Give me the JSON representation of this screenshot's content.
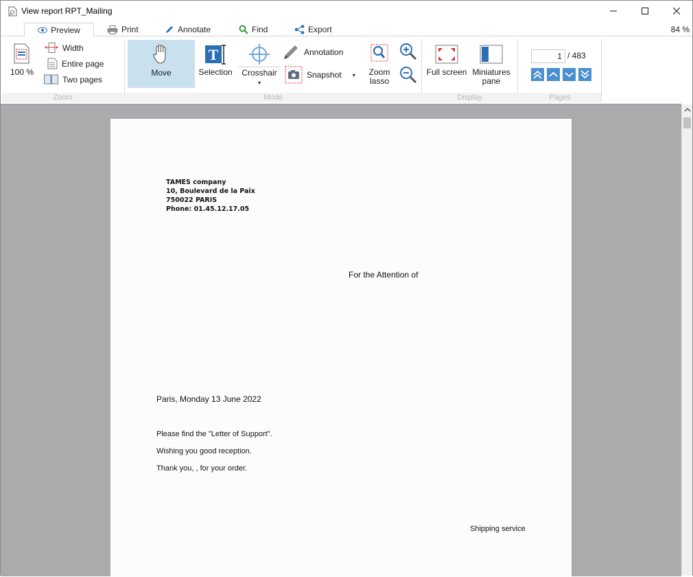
{
  "window": {
    "title": "View report RPT_Mailing"
  },
  "tabs": [
    {
      "label": "Preview",
      "icon": "eye-icon"
    },
    {
      "label": "Print",
      "icon": "printer-icon"
    },
    {
      "label": "Annotate",
      "icon": "pencil-icon"
    },
    {
      "label": "Find",
      "icon": "magnifier-icon"
    },
    {
      "label": "Export",
      "icon": "share-icon"
    }
  ],
  "zoom_level": "84 %",
  "ribbon": {
    "zoom": {
      "percent_label": "100 %",
      "width_label": "Width",
      "entire_page_label": "Entire page",
      "two_pages_label": "Two pages",
      "group_label": "Zoom"
    },
    "mode": {
      "move_label": "Move",
      "selection_label": "Selection",
      "crosshair_label": "Crosshair",
      "annotation_label": "Annotation",
      "snapshot_label": "Snapshot",
      "zoom_lasso_label_1": "Zoom",
      "zoom_lasso_label_2": "lasso",
      "group_label": "Mode"
    },
    "display": {
      "full_screen_label": "Full screen",
      "miniatures_label_1": "Miniatures",
      "miniatures_label_2": "pane",
      "group_label": "Display"
    },
    "pages": {
      "current_page": "1",
      "total_pages": "/ 483",
      "group_label": "Pages"
    }
  },
  "document": {
    "company_lines": [
      "TAMES company",
      "10, Boulevard de la Paix",
      "750022 PARIS",
      "Phone: 01.45.12.17.05"
    ],
    "attention": "For the Attention of",
    "date": "Paris, Monday 13 June 2022",
    "body_lines": [
      "Please find the \"Letter of Support\".",
      "Wishing you good reception.",
      "Thank you,  , for your order."
    ],
    "signature": "Shipping service"
  },
  "colors": {
    "accent_blue": "#4a8fcf",
    "move_active_bg": "#c9e0ef",
    "viewer_bg": "#abaaad"
  }
}
